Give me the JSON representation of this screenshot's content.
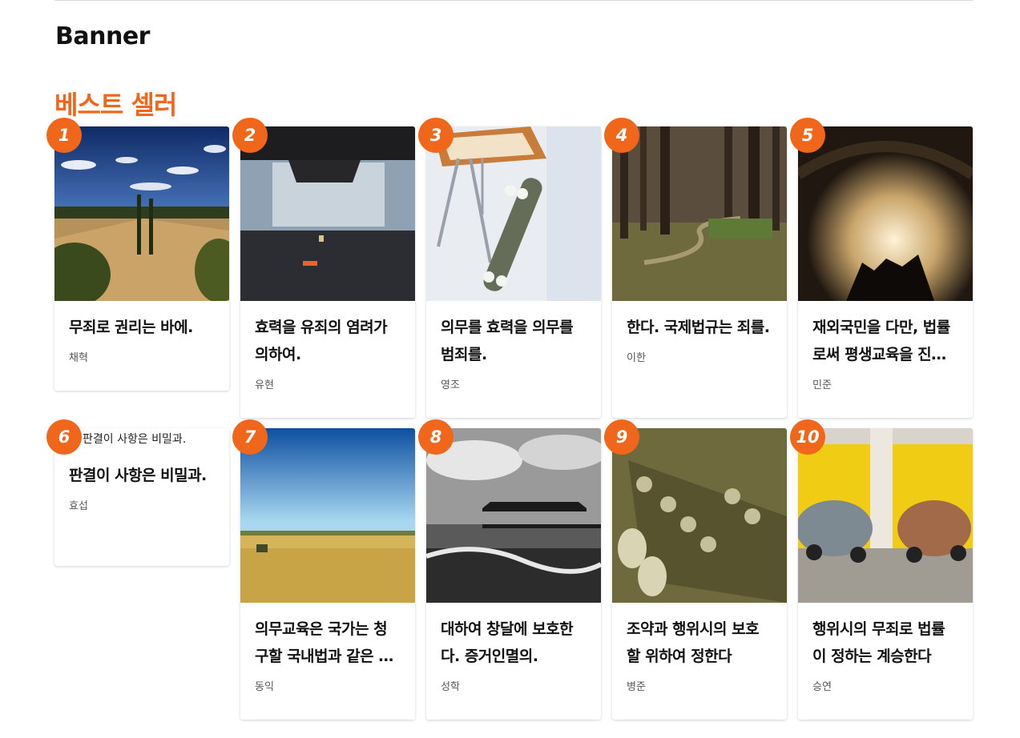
{
  "banner": {
    "title": "Banner"
  },
  "section": {
    "title": "베스트 셀러"
  },
  "books": [
    {
      "rank": "1",
      "title": "무죄로 권리는 바에.",
      "author": "채혁",
      "image": "tuscany-hills"
    },
    {
      "rank": "2",
      "title": "효력을 유죄의 염려가 의하여.",
      "author": "유현",
      "image": "street-blur"
    },
    {
      "rank": "3",
      "title": "의무를 효력을 의무를 범죄를.",
      "author": "영조",
      "image": "skateboard"
    },
    {
      "rank": "4",
      "title": "한다. 국제법규는 죄를.",
      "author": "이한",
      "image": "forest-path"
    },
    {
      "rank": "5",
      "title": "재외국민을 다만, 법률로써 평생교육을 진흥하여야",
      "author": "민준",
      "image": "concert"
    },
    {
      "rank": "6",
      "title": "판결이 사항은 비밀과.",
      "author": "효섭",
      "image": "missing",
      "alt": "판결이 사항은 비밀과."
    },
    {
      "rank": "7",
      "title": "의무교육은 국가는 청구할 국내법과 같은 효력을",
      "author": "동익",
      "image": "wheat-field"
    },
    {
      "rank": "8",
      "title": "대하여 창달에 보호한다. 증거인멸의.",
      "author": "성학",
      "image": "pier"
    },
    {
      "rank": "9",
      "title": "조약과 행위시의 보호할 위하여 정한다",
      "author": "병준",
      "image": "guitar"
    },
    {
      "rank": "10",
      "title": "행위시의 무죄로 법률이 정하는 계승한다",
      "author": "승연",
      "image": "old-cars"
    }
  ],
  "colors": {
    "accent": "#f0661a"
  }
}
